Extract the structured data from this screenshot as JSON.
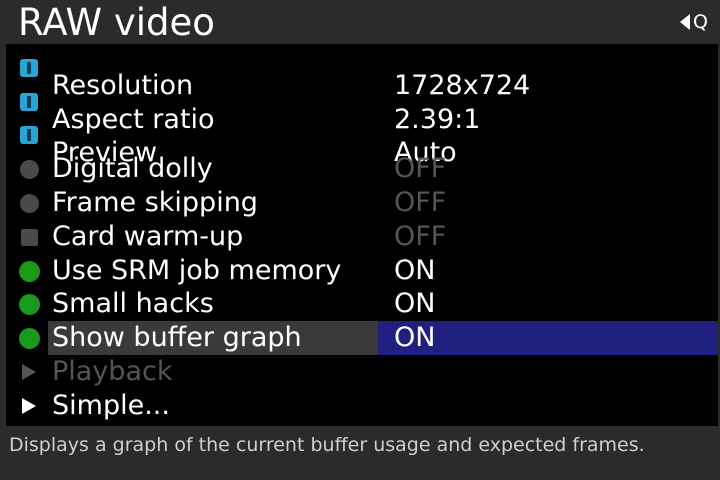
{
  "header": {
    "title": "RAW video",
    "q_hint": "Q"
  },
  "menu": {
    "items": [
      {
        "label": "Resolution",
        "value": "1728x724",
        "indicator": "blue-square",
        "label_dim": false,
        "value_dim": false
      },
      {
        "label": "Aspect ratio",
        "value": "2.39:1",
        "indicator": "blue-square",
        "label_dim": false,
        "value_dim": false
      },
      {
        "label": "Preview",
        "value": "Auto",
        "indicator": "blue-square",
        "label_dim": false,
        "value_dim": false
      },
      {
        "label": "Digital dolly",
        "value": "OFF",
        "indicator": "gray-circle",
        "label_dim": false,
        "value_dim": true
      },
      {
        "label": "Frame skipping",
        "value": "OFF",
        "indicator": "gray-circle",
        "label_dim": false,
        "value_dim": true
      },
      {
        "label": "Card warm-up",
        "value": "OFF",
        "indicator": "gray-square",
        "label_dim": false,
        "value_dim": true
      },
      {
        "label": "Use SRM job memory",
        "value": "ON",
        "indicator": "green-circle",
        "label_dim": false,
        "value_dim": false
      },
      {
        "label": "Small hacks",
        "value": "ON",
        "indicator": "green-circle",
        "label_dim": false,
        "value_dim": false
      },
      {
        "label": "Show buffer graph",
        "value": "ON",
        "indicator": "green-circle",
        "label_dim": false,
        "value_dim": false,
        "selected": true
      },
      {
        "label": "Playback",
        "value": "",
        "indicator": "triangle-dim",
        "label_dim": true,
        "value_dim": false
      },
      {
        "label": "Simple...",
        "value": "",
        "indicator": "triangle",
        "label_dim": false,
        "value_dim": false
      }
    ]
  },
  "help": {
    "text": "Displays a graph of the current buffer usage and expected frames."
  },
  "colors": {
    "indicator_blue": "#2aa4d4",
    "indicator_green": "#1a9a1a",
    "indicator_gray": "#4a4a4a",
    "selection_value_bg": "#202080",
    "selection_label_bg": "#3a3a3a",
    "dim_text": "#555555"
  }
}
